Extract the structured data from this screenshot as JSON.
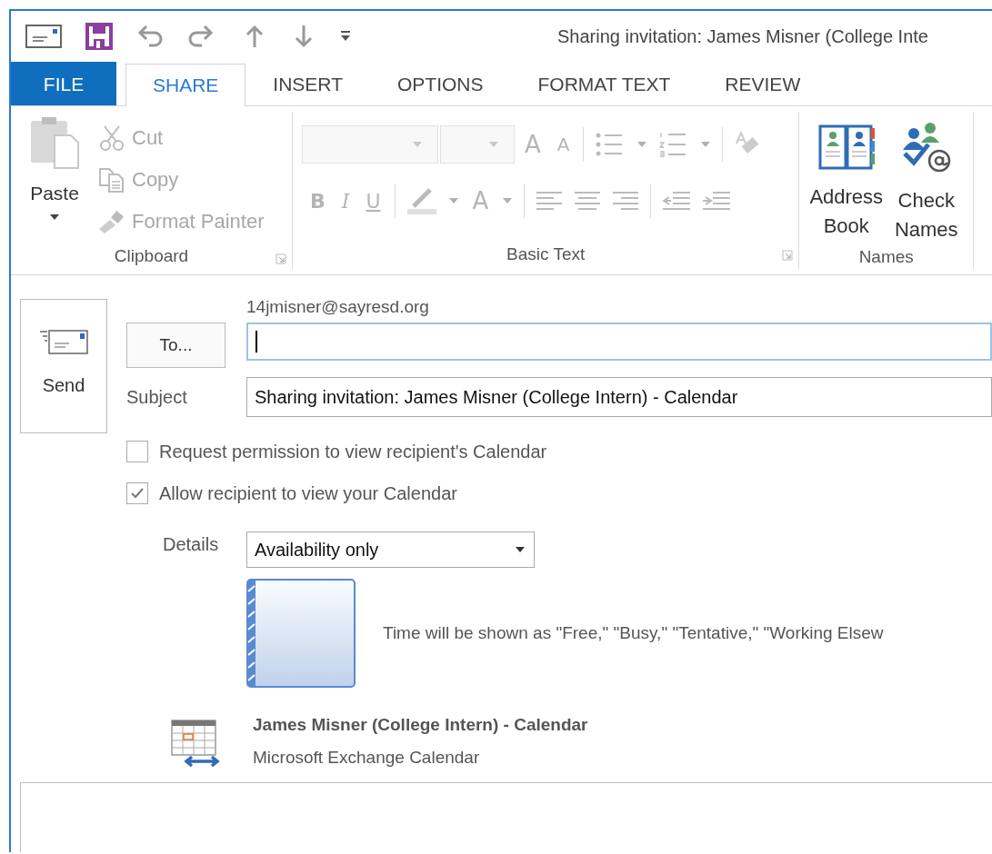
{
  "window": {
    "title": "Sharing invitation: James Misner (College Inte"
  },
  "tabs": [
    {
      "label": "FILE",
      "kind": "file",
      "selected": false
    },
    {
      "label": "SHARE",
      "kind": "tab",
      "selected": true
    },
    {
      "label": "INSERT",
      "kind": "tab",
      "selected": false
    },
    {
      "label": "OPTIONS",
      "kind": "tab",
      "selected": false
    },
    {
      "label": "FORMAT TEXT",
      "kind": "tab",
      "selected": false
    },
    {
      "label": "REVIEW",
      "kind": "tab",
      "selected": false
    }
  ],
  "ribbon": {
    "clipboard": {
      "label": "Clipboard",
      "launcher": true,
      "paste": {
        "label": "Paste",
        "disabled": false
      },
      "items": [
        {
          "kind": "cut",
          "label": "Cut",
          "disabled": true
        },
        {
          "kind": "copy",
          "label": "Copy",
          "disabled": true
        },
        {
          "kind": "format-painter",
          "label": "Format Painter",
          "disabled": true
        }
      ]
    },
    "basic_text": {
      "label": "Basic Text",
      "launcher": true,
      "disabled": true,
      "grow_font": "A",
      "shrink_font": "A",
      "bold": "B",
      "italic": "I",
      "underline": "U",
      "font_color": "A"
    },
    "names": {
      "label": "Names",
      "items": [
        {
          "kind": "address-book",
          "label": "Address Book"
        },
        {
          "kind": "check-names",
          "label": "Check Names"
        }
      ]
    }
  },
  "message": {
    "from": "14jmisner@sayresd.org",
    "send_button": "Send",
    "to_button": "To...",
    "to_field": {
      "focused": true
    },
    "subject_label": "Subject",
    "subject": "Sharing invitation: James Misner (College Intern) - Calendar",
    "checkboxes": [
      {
        "label": "Request permission to view recipient's Calendar",
        "checked": false
      },
      {
        "label": "Allow recipient to view your Calendar",
        "checked": true
      }
    ],
    "details_label": "Details",
    "details_value": "Availability only",
    "preview_text": "Time will be shown as \"Free,\" \"Busy,\" \"Tentative,\" \"Working Elsew",
    "calendar": {
      "title": "James Misner (College Intern) - Calendar",
      "subtitle": "Microsoft Exchange Calendar"
    }
  }
}
